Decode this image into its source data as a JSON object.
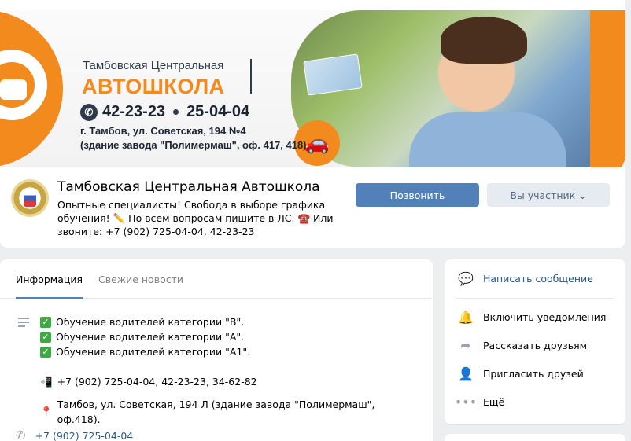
{
  "cover": {
    "brand_subtitle": "Тамбовская Центральная",
    "brand_title": "АВТОШКОЛА",
    "phone_1": "42-23-23",
    "phone_2": "25-04-04",
    "address_line_1": "г. Тамбов, ул. Советская, 194 №4",
    "address_line_2": "(здание завода \"Полимермаш\", оф. 417, 418)"
  },
  "group": {
    "name": "Тамбовская Центральная Автошкола",
    "status": "Опытные специалисты! Свобода в выборе графика обучения! ✏️ По всем вопросам пишите в ЛС. ☎️ Или звоните: +7 (902) 725-04-04, 42-23-23",
    "call_button": "Позвонить",
    "member_button": "Вы участник",
    "member_chevron": "⌄"
  },
  "tabs": [
    {
      "label": "Информация"
    },
    {
      "label": "Свежие новости"
    }
  ],
  "description": {
    "items": [
      "Обучение водителей категории \"B\".",
      "Обучение водителей категории \"A\".",
      "Обучение водителей категории \"A1\"."
    ],
    "check_glyph": "✓",
    "phones_emoji": "📲",
    "phones": "+7 (902) 725-04-04, 42-23-23, 34-62-82",
    "pin_emoji": "📍",
    "address": "Тамбов, ул. Советская, 194 Л (здание завода \"Полимермаш\", оф.418)."
  },
  "contact_phone": "+7 (902) 725-04-04",
  "actions": {
    "message": "Написать сообщение",
    "notifications": "Включить уведомления",
    "share": "Рассказать друзьям",
    "invite": "Пригласить друзей",
    "more": "Ещё"
  },
  "icons": {
    "message": "💬",
    "bell": "🔔",
    "share": "➦",
    "invite": "👤",
    "more": "•••",
    "phone": "✆",
    "car": "🚗"
  },
  "colors": {
    "accent": "#5181b8",
    "link": "#2a5885",
    "brand_orange": "#f28a1e",
    "background": "#edeef0"
  }
}
